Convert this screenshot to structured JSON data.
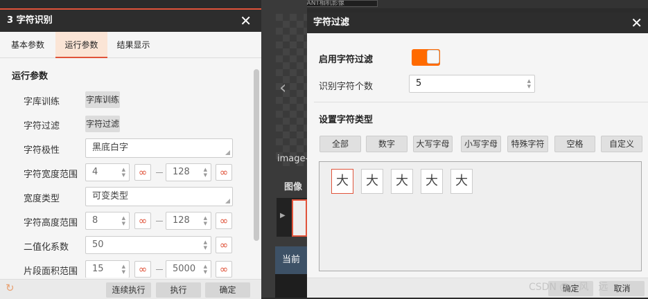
{
  "top_bar": {
    "tab_text": "ULUTANT相机影像"
  },
  "left_panel": {
    "title": "3 字符识别",
    "tabs": [
      "基本参数",
      "运行参数",
      "结果显示"
    ],
    "active_tab": 1,
    "section_title": "运行参数",
    "rows": {
      "lib_train_label": "字库训练",
      "lib_train_button": "字库训练",
      "filter_label": "字符过滤",
      "filter_button": "字符过滤",
      "polarity_label": "字符极性",
      "polarity_value": "黑底白字",
      "width_range_label": "字符宽度范围",
      "width_min": "4",
      "width_max": "128",
      "width_type_label": "宽度类型",
      "width_type_value": "可变类型",
      "height_range_label": "字符高度范围",
      "height_min": "8",
      "height_max": "128",
      "binarize_label": "二值化系数",
      "binarize_value": "50",
      "area_range_label": "片段面积范围",
      "area_min": "15",
      "area_max": "5000"
    },
    "footer": {
      "continuous_run": "连续执行",
      "run": "执行",
      "ok": "确定"
    }
  },
  "middle": {
    "image_label": "image-",
    "image_tab": "图像",
    "current": "当前"
  },
  "right_panel": {
    "title": "字符过滤",
    "enable_label": "启用字符过滤",
    "enable_on": true,
    "count_label": "识别字符个数",
    "count_value": "5",
    "type_section": "设置字符类型",
    "type_buttons": [
      "全部",
      "数字",
      "大写字母",
      "小写字母",
      "特殊字符",
      "空格",
      "自定义"
    ],
    "chars": [
      "大",
      "大",
      "大",
      "大",
      "大"
    ],
    "footer": {
      "ok": "确定",
      "cancel": "取消"
    }
  },
  "watermark": "CSDN @　风　远",
  "colors": {
    "accent": "#e0533a",
    "toggle": "#ff6a00",
    "titlebar": "#2d2d2d"
  }
}
